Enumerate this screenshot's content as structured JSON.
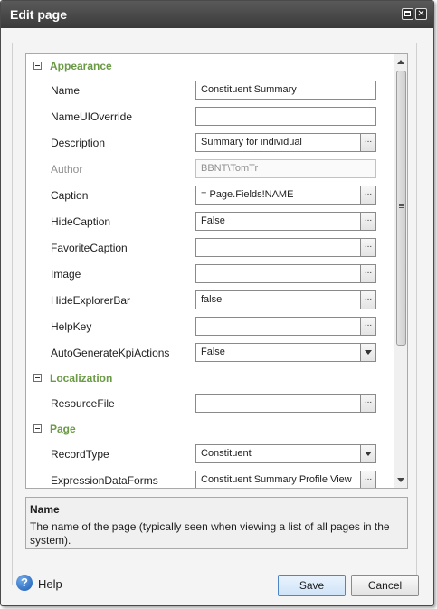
{
  "dialog": {
    "title": "Edit page",
    "maximize_icon": "maximize-icon",
    "close_icon": "close-icon"
  },
  "grid": {
    "categories": [
      {
        "label": "Appearance"
      },
      {
        "label": "Localization"
      },
      {
        "label": "Page"
      }
    ],
    "properties": {
      "name": {
        "label": "Name",
        "value": "Constituent Summary"
      },
      "name_ui_override": {
        "label": "NameUIOverride",
        "value": ""
      },
      "description": {
        "label": "Description",
        "value": "Summary for individual",
        "button": "..."
      },
      "author": {
        "label": "Author",
        "value": "BBNT\\TomTr"
      },
      "caption": {
        "label": "Caption",
        "value": "= Page.Fields!NAME",
        "button": "..."
      },
      "hide_caption": {
        "label": "HideCaption",
        "value": "False",
        "button": "..."
      },
      "favorite_caption": {
        "label": "FavoriteCaption",
        "value": "",
        "button": "..."
      },
      "image": {
        "label": "Image",
        "value": "",
        "button": "..."
      },
      "hide_explorer_bar": {
        "label": "HideExplorerBar",
        "value": "false",
        "button": "..."
      },
      "help_key": {
        "label": "HelpKey",
        "value": "",
        "button": "..."
      },
      "auto_generate_kpi_actions": {
        "label": "AutoGenerateKpiActions",
        "value": "False"
      },
      "resource_file": {
        "label": "ResourceFile",
        "value": "",
        "button": "..."
      },
      "record_type": {
        "label": "RecordType",
        "value": "Constituent"
      },
      "expression_data_forms": {
        "label": "ExpressionDataForms",
        "value": "Constituent Summary Profile View",
        "button": "..."
      }
    }
  },
  "description_panel": {
    "name": "Name",
    "text": "The name of the page (typically seen when viewing a list of all pages in the system)."
  },
  "footer": {
    "help_label": "Help",
    "help_icon": "?",
    "save_label": "Save",
    "cancel_label": "Cancel"
  },
  "colors": {
    "category": "#6a9a46",
    "titlebar": "#3a3a3a",
    "primary_button_border": "#4f85c6"
  }
}
